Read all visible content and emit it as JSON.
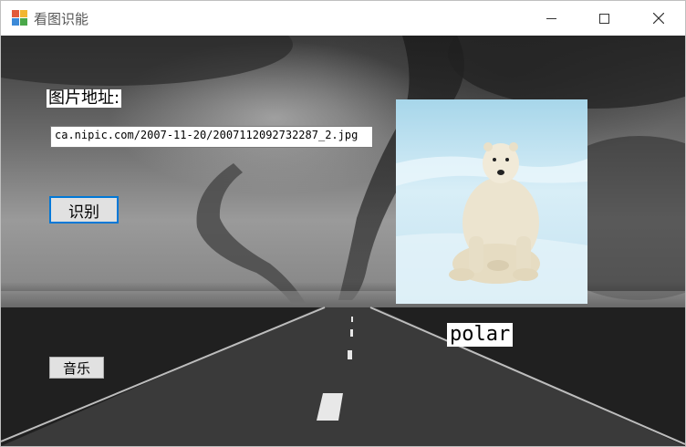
{
  "window": {
    "title": "看图识能",
    "controls": {
      "minimize": "minimize",
      "maximize": "maximize",
      "close": "close"
    }
  },
  "form": {
    "url_label": "图片地址:",
    "url_value": "ca.nipic.com/2007-11-20/2007112092732287_2.jpg",
    "recognize_button": "识别",
    "music_button": "音乐",
    "result_text": "polar"
  },
  "image": {
    "subject": "polar-bear-on-snow",
    "icon": "photo"
  },
  "colors": {
    "focus_border": "#0078d7",
    "button_face": "#e1e1e1"
  }
}
